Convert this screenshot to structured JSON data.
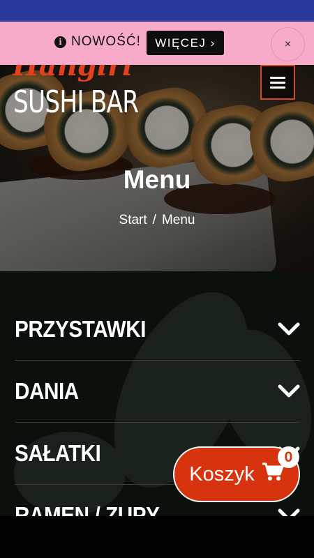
{
  "promo": {
    "info_symbol": "i",
    "text": "NOWOŚĆ!",
    "more_label": "WIĘCEJ ›",
    "close_symbol": "×"
  },
  "logo": {
    "script_text": "Hangiri",
    "main_text": "SUSHI BAR"
  },
  "header": {
    "menu_icon": "hamburger-icon"
  },
  "page": {
    "title": "Menu",
    "breadcrumb": {
      "home": "Start",
      "separator": "/",
      "current": "Menu"
    }
  },
  "categories": [
    {
      "label": "PRZYSTAWKI",
      "icon": "chevron-down-icon"
    },
    {
      "label": "DANIA",
      "icon": "chevron-down-icon"
    },
    {
      "label": "SAŁATKI",
      "icon": "chevron-down-icon"
    },
    {
      "label": "RAMEN / ZUPY",
      "icon": "chevron-down-icon"
    }
  ],
  "cart": {
    "label": "Koszyk",
    "count": "0",
    "icon": "cart-icon"
  },
  "colors": {
    "status_bar": "#2b3a9a",
    "promo_background": "#f8aac9",
    "accent": "#d8330f",
    "menu_background": "#0c100d"
  }
}
